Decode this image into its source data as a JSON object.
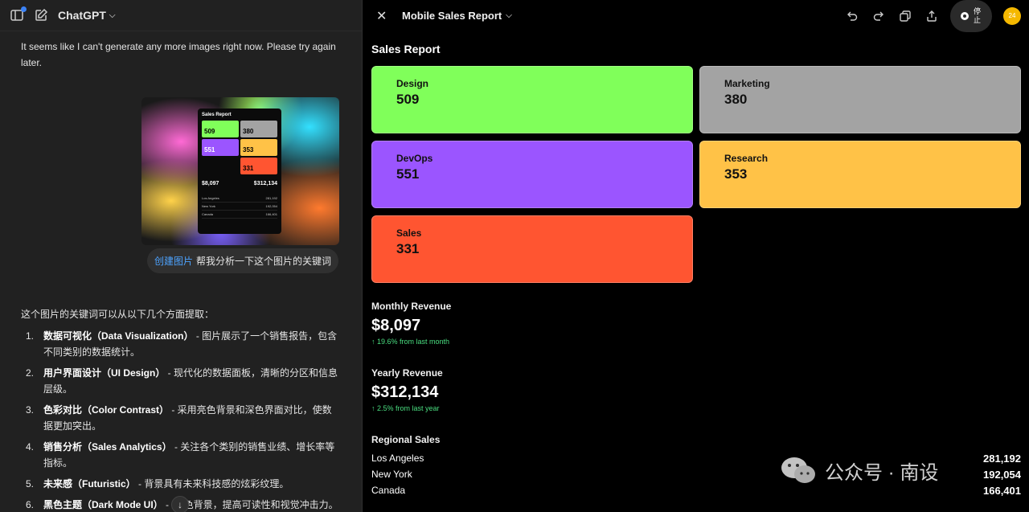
{
  "left": {
    "model": "ChatGPT",
    "assistant_message_1": "It seems like I can't generate any more images right now. Please try again later.",
    "thumbnail": {
      "title": "Sales Report",
      "tiles": [
        "509",
        "380",
        "551",
        "353",
        "331"
      ],
      "monthly": "$8,097",
      "yearly": "$312,134",
      "rows": [
        {
          "city": "Los Angeles",
          "value": "281,192"
        },
        {
          "city": "New York",
          "value": "192,054"
        },
        {
          "city": "Canada",
          "value": "166,401"
        }
      ]
    },
    "user_message": {
      "tag": "创建图片",
      "text": "帮我分析一下这个图片的关键词"
    },
    "answer_intro": "这个图片的关键词可以从以下几个方面提取：",
    "answer_items": [
      {
        "num": "1.",
        "title": "数据可视化（Data Visualization）",
        "text": " - 图片展示了一个销售报告，包含不同类别的数据统计。"
      },
      {
        "num": "2.",
        "title": "用户界面设计（UI Design）",
        "text": " - 现代化的数据面板，清晰的分区和信息层级。"
      },
      {
        "num": "3.",
        "title": "色彩对比（Color Contrast）",
        "text": " - 采用亮色背景和深色界面对比，使数据更加突出。"
      },
      {
        "num": "4.",
        "title": "销售分析（Sales Analytics）",
        "text": " - 关注各个类别的销售业绩、增长率等指标。"
      },
      {
        "num": "5.",
        "title": "未来感（Futuristic）",
        "text": " - 背景具有未来科技感的炫彩纹理。"
      },
      {
        "num": "6.",
        "title": "黑色主题（Dark Mode UI）",
        "text": " - 采  色背景，提高可读性和视觉冲击力。"
      }
    ]
  },
  "right": {
    "doc_title": "Mobile Sales Report",
    "stop_label": "停止",
    "avatar_text": "24",
    "report_title": "Sales Report",
    "tiles": [
      {
        "label": "Design",
        "value": "509",
        "color": "#80ff5a"
      },
      {
        "label": "Marketing",
        "value": "380",
        "color": "#a3a3a3"
      },
      {
        "label": "DevOps",
        "value": "551",
        "color": "#9b55ff"
      },
      {
        "label": "Research",
        "value": "353",
        "color": "#ffc247"
      },
      {
        "label": "Sales",
        "value": "331",
        "color": "#ff5531"
      }
    ],
    "monthly": {
      "label": "Monthly Revenue",
      "value": "$8,097",
      "delta": "↑ 19.6% from last month"
    },
    "yearly": {
      "label": "Yearly Revenue",
      "value": "$312,134",
      "delta": "↑ 2.5% from last year"
    },
    "regional": {
      "label": "Regional Sales",
      "rows": [
        {
          "city": "Los Angeles",
          "value": "281,192"
        },
        {
          "city": "New York",
          "value": "192,054"
        },
        {
          "city": "Canada",
          "value": "166,401"
        }
      ]
    },
    "watermark": "公众号 · 南设"
  }
}
